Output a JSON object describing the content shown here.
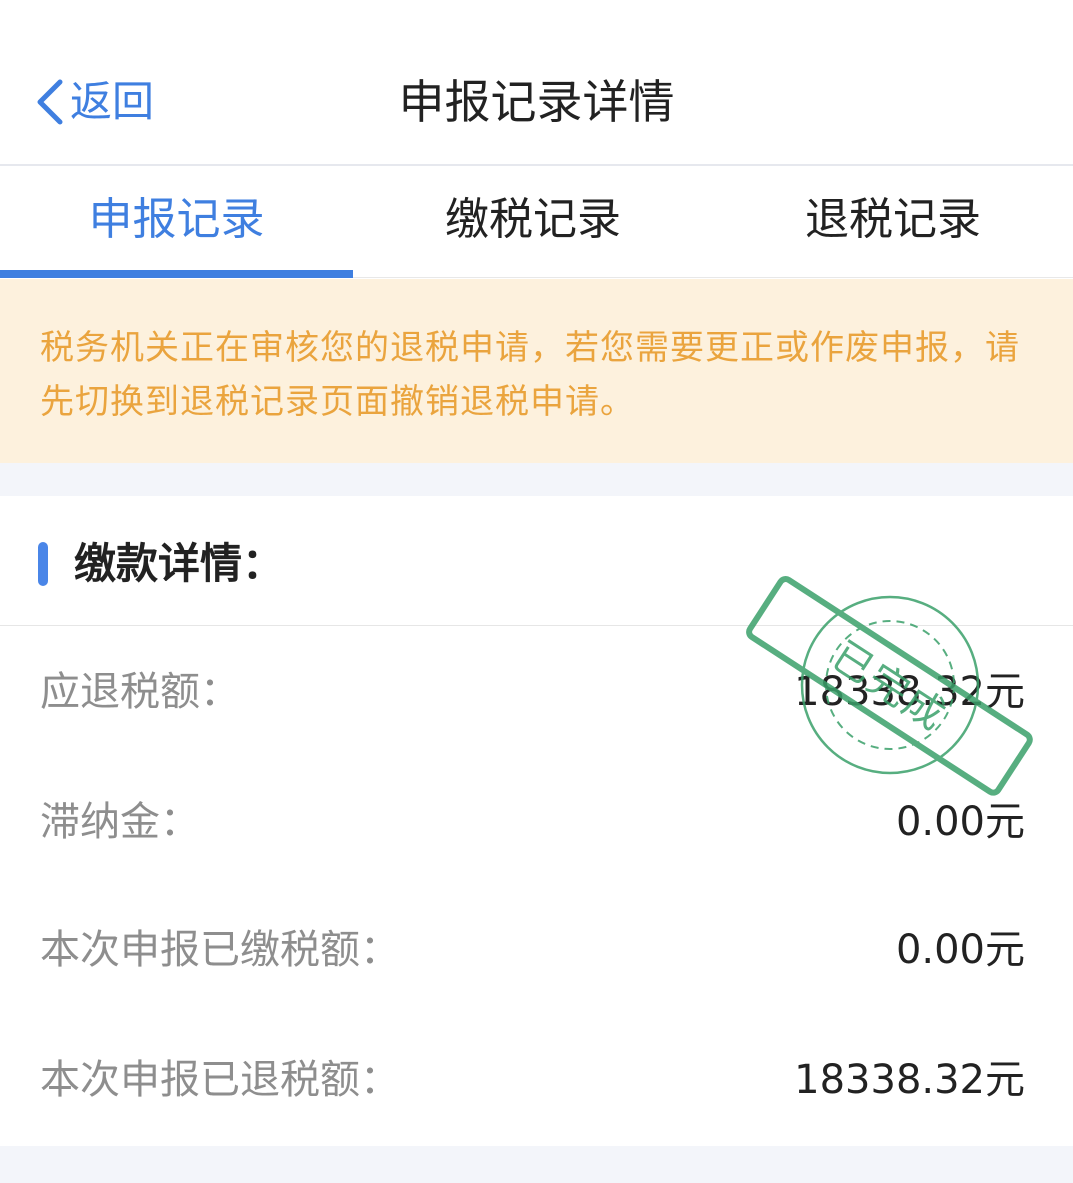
{
  "nav": {
    "back_label": "返回",
    "title": "申报记录详情"
  },
  "tabs": [
    {
      "label": "申报记录",
      "active": true
    },
    {
      "label": "缴税记录",
      "active": false
    },
    {
      "label": "退税记录",
      "active": false
    }
  ],
  "notice": {
    "text": "税务机关正在审核您的退税申请，若您需要更正或作废申报，请先切换到退税记录页面撤销退税申请。"
  },
  "section": {
    "title": "缴款详情："
  },
  "rows": [
    {
      "label": "应退税额：",
      "value": "18338.32元"
    },
    {
      "label": "滞纳金：",
      "value": "0.00元"
    },
    {
      "label": "本次申报已缴税额：",
      "value": "0.00元"
    },
    {
      "label": "本次申报已退税额：",
      "value": "18338.32元"
    }
  ],
  "stamp": {
    "text": "已完成",
    "color": "#3aa06a"
  },
  "colors": {
    "accent": "#3f7fe0",
    "notice_text": "#eaa43e",
    "notice_bg": "#fdf1dd"
  }
}
